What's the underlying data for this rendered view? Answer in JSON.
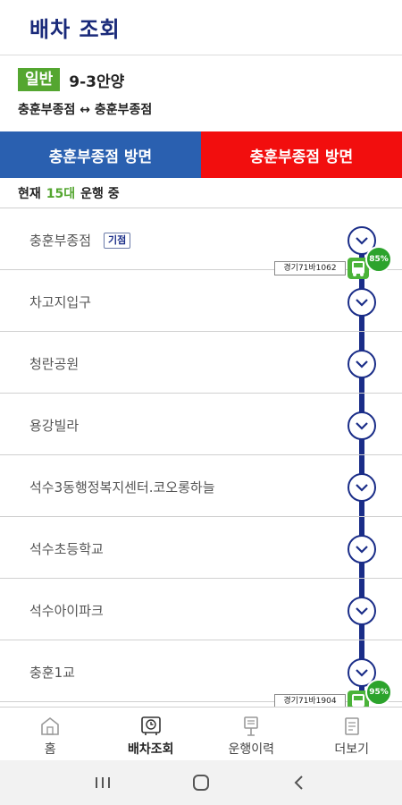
{
  "header": {
    "title": "배차 조회"
  },
  "route": {
    "badge": "일반",
    "number": "9-3안양",
    "path": "충훈부종점 ↔ 충훈부종점"
  },
  "directions": {
    "left": "충훈부종점 방면",
    "right": "충훈부종점 방면"
  },
  "running": {
    "prefix": "현재",
    "count": "15대",
    "suffix": "운행 중"
  },
  "stops": [
    {
      "name": "충훈부종점",
      "tag": "기점"
    },
    {
      "name": "차고지입구"
    },
    {
      "name": "청란공원"
    },
    {
      "name": "용강빌라"
    },
    {
      "name": "석수3동행정복지센터.코오롱하늘"
    },
    {
      "name": "석수초등학교"
    },
    {
      "name": "석수아이파크"
    },
    {
      "name": "충훈1교"
    }
  ],
  "buses": [
    {
      "plate": "경기71바1062",
      "occupancy": "85%"
    },
    {
      "plate": "경기71바1904",
      "occupancy": "95%"
    }
  ],
  "nav": [
    {
      "label": "홈",
      "icon": "home-icon"
    },
    {
      "label": "배차조회",
      "icon": "dispatch-clock-icon"
    },
    {
      "label": "운행이력",
      "icon": "history-icon"
    },
    {
      "label": "더보기",
      "icon": "more-icon"
    }
  ],
  "colors": {
    "title": "#1a2a7a",
    "badge": "#54a630",
    "tab_left": "#2a60b0",
    "tab_right": "#f20e0e",
    "line": "#1a2d88",
    "occupancy": "#2ca32c"
  }
}
